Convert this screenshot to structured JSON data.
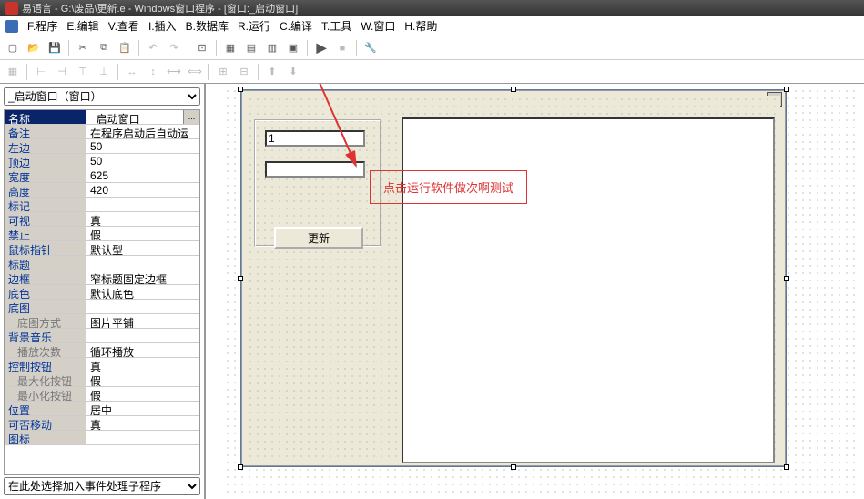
{
  "title_bar": "易语言 - G:\\废品\\更新.e - Windows窗口程序 - [窗口:_启动窗口]",
  "menu": {
    "m1": "F.程序",
    "m2": "E.编辑",
    "m3": "V.查看",
    "m4": "I.插入",
    "m5": "B.数据库",
    "m6": "R.运行",
    "m7": "C.编译",
    "m8": "T.工具",
    "m9": "W.窗口",
    "m10": "H.帮助"
  },
  "left": {
    "selector": "_启动窗口（窗口）",
    "bottom": "在此处选择加入事件处理子程序"
  },
  "props": [
    {
      "label": "名称",
      "value": "_启动窗口",
      "active": true,
      "btn": "..."
    },
    {
      "label": "备注",
      "value": "在程序启动后自动运"
    },
    {
      "label": "左边",
      "value": "50"
    },
    {
      "label": "顶边",
      "value": "50"
    },
    {
      "label": "宽度",
      "value": "625"
    },
    {
      "label": "高度",
      "value": "420"
    },
    {
      "label": "标记",
      "value": ""
    },
    {
      "label": "可视",
      "value": "真"
    },
    {
      "label": "禁止",
      "value": "假"
    },
    {
      "label": "鼠标指针",
      "value": "默认型"
    },
    {
      "label": "标题",
      "value": ""
    },
    {
      "label": "边框",
      "value": "窄标题固定边框"
    },
    {
      "label": "底色",
      "value": "默认底色"
    },
    {
      "label": "底图",
      "value": ""
    },
    {
      "label": "底图方式",
      "value": "图片平铺",
      "indent": true
    },
    {
      "label": "背景音乐",
      "value": ""
    },
    {
      "label": "播放次数",
      "value": "循环播放",
      "indent": true
    },
    {
      "label": "控制按钮",
      "value": "真"
    },
    {
      "label": "最大化按钮",
      "value": "假",
      "indent": true
    },
    {
      "label": "最小化按钮",
      "value": "假",
      "indent": true
    },
    {
      "label": "位置",
      "value": "居中"
    },
    {
      "label": "可否移动",
      "value": "真"
    },
    {
      "label": "图标",
      "value": ""
    }
  ],
  "form": {
    "textbox1_value": "1",
    "update_btn": "更新"
  },
  "annotation": "点击运行软件做次啊测试"
}
